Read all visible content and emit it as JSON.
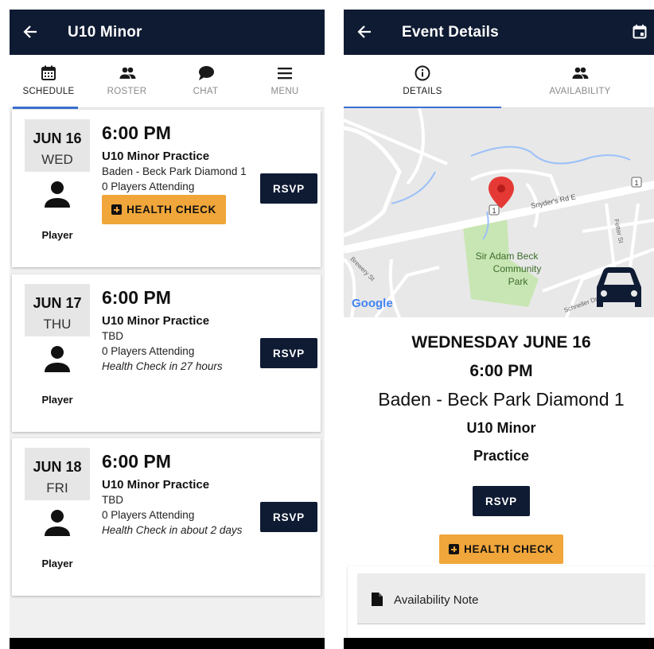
{
  "colors": {
    "appbar": "#0f1b33",
    "accent": "#3b6fd0",
    "health_check": "#f0a63a",
    "rsvp": "#0f1b33"
  },
  "left": {
    "appbar": {
      "title": "U10 Minor",
      "back_icon": "arrow-left-icon"
    },
    "tabs": [
      {
        "label": "SCHEDULE",
        "icon": "calendar-icon",
        "active": true
      },
      {
        "label": "ROSTER",
        "icon": "group-icon",
        "active": false
      },
      {
        "label": "CHAT",
        "icon": "chat-bubble-icon",
        "active": false
      },
      {
        "label": "MENU",
        "icon": "hamburger-icon",
        "active": false
      }
    ],
    "events": [
      {
        "month_day": "JUN 16",
        "weekday": "WED",
        "time": "6:00 PM",
        "name": "U10 Minor Practice",
        "location": "Baden - Beck Park Diamond 1",
        "attending": "0 Players Attending",
        "health_check_note": "",
        "health_check_button": "HEALTH CHECK",
        "role": "Player",
        "rsvp": "RSVP"
      },
      {
        "month_day": "JUN 17",
        "weekday": "THU",
        "time": "6:00 PM",
        "name": "U10 Minor Practice",
        "location": "TBD",
        "attending": "0 Players Attending",
        "health_check_note": "Health Check in 27 hours",
        "health_check_button": "",
        "role": "Player",
        "rsvp": "RSVP"
      },
      {
        "month_day": "JUN 18",
        "weekday": "FRI",
        "time": "6:00 PM",
        "name": "U10 Minor Practice",
        "location": "TBD",
        "attending": "0 Players Attending",
        "health_check_note": "Health Check in about 2 days",
        "health_check_button": "",
        "role": "Player",
        "rsvp": "RSVP"
      }
    ]
  },
  "right": {
    "appbar": {
      "title": "Event Details",
      "back_icon": "arrow-left-icon",
      "action_icon": "calendar-today-icon"
    },
    "tabs": [
      {
        "label": "DETAILS",
        "icon": "info-icon",
        "active": true
      },
      {
        "label": "AVAILABILITY",
        "icon": "group-icon",
        "active": false
      }
    ],
    "map": {
      "road_label": "Snyder's Rd E",
      "street_fetter": "Fetter St",
      "street_brewery": "Brewery St",
      "street_schneller": "Schneller Dr",
      "park_label": "Sir Adam Beck Community Park",
      "route_badge": "1",
      "attribution": "Google",
      "pin_icon": "map-pin-icon",
      "directions_icon": "car-icon"
    },
    "event": {
      "date": "WEDNESDAY JUNE 16",
      "time": "6:00 PM",
      "location": "Baden - Beck Park Diamond 1",
      "team": "U10 Minor",
      "type": "Practice",
      "rsvp": "RSVP",
      "health_check": "HEALTH CHECK"
    },
    "availability_note": {
      "label": "Availability Note",
      "icon": "note-icon"
    }
  }
}
